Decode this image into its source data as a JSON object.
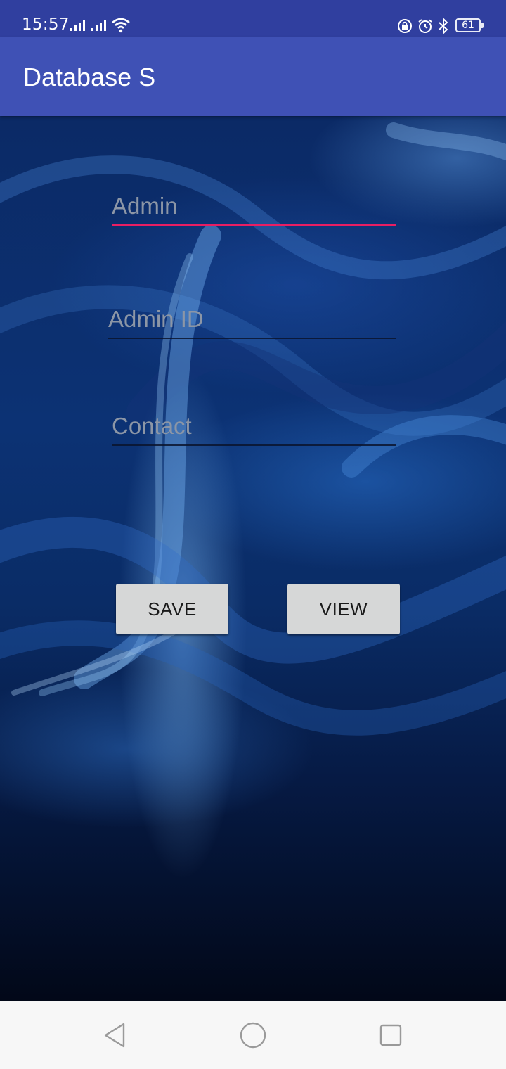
{
  "status_bar": {
    "time": "15:57",
    "battery_level": "61",
    "icons": [
      "signal-icon",
      "signal-icon",
      "wifi-icon",
      "lock-rotation-icon",
      "alarm-icon",
      "bluetooth-icon",
      "battery-icon"
    ]
  },
  "app_bar": {
    "title": "Database S"
  },
  "form": {
    "admin_placeholder": "Admin",
    "admin_id_placeholder": "Admin ID",
    "contact_placeholder": "Contact",
    "save_label": "SAVE",
    "view_label": "VIEW"
  },
  "colors": {
    "status_bar": "#303F9F",
    "app_bar": "#3F51B5",
    "accent": "#E91E63",
    "button_bg": "#D6D7D7",
    "nav_bar": "#F7F7F7"
  },
  "nav_bar": {
    "icons": [
      "back-icon",
      "home-icon",
      "recents-icon"
    ]
  }
}
